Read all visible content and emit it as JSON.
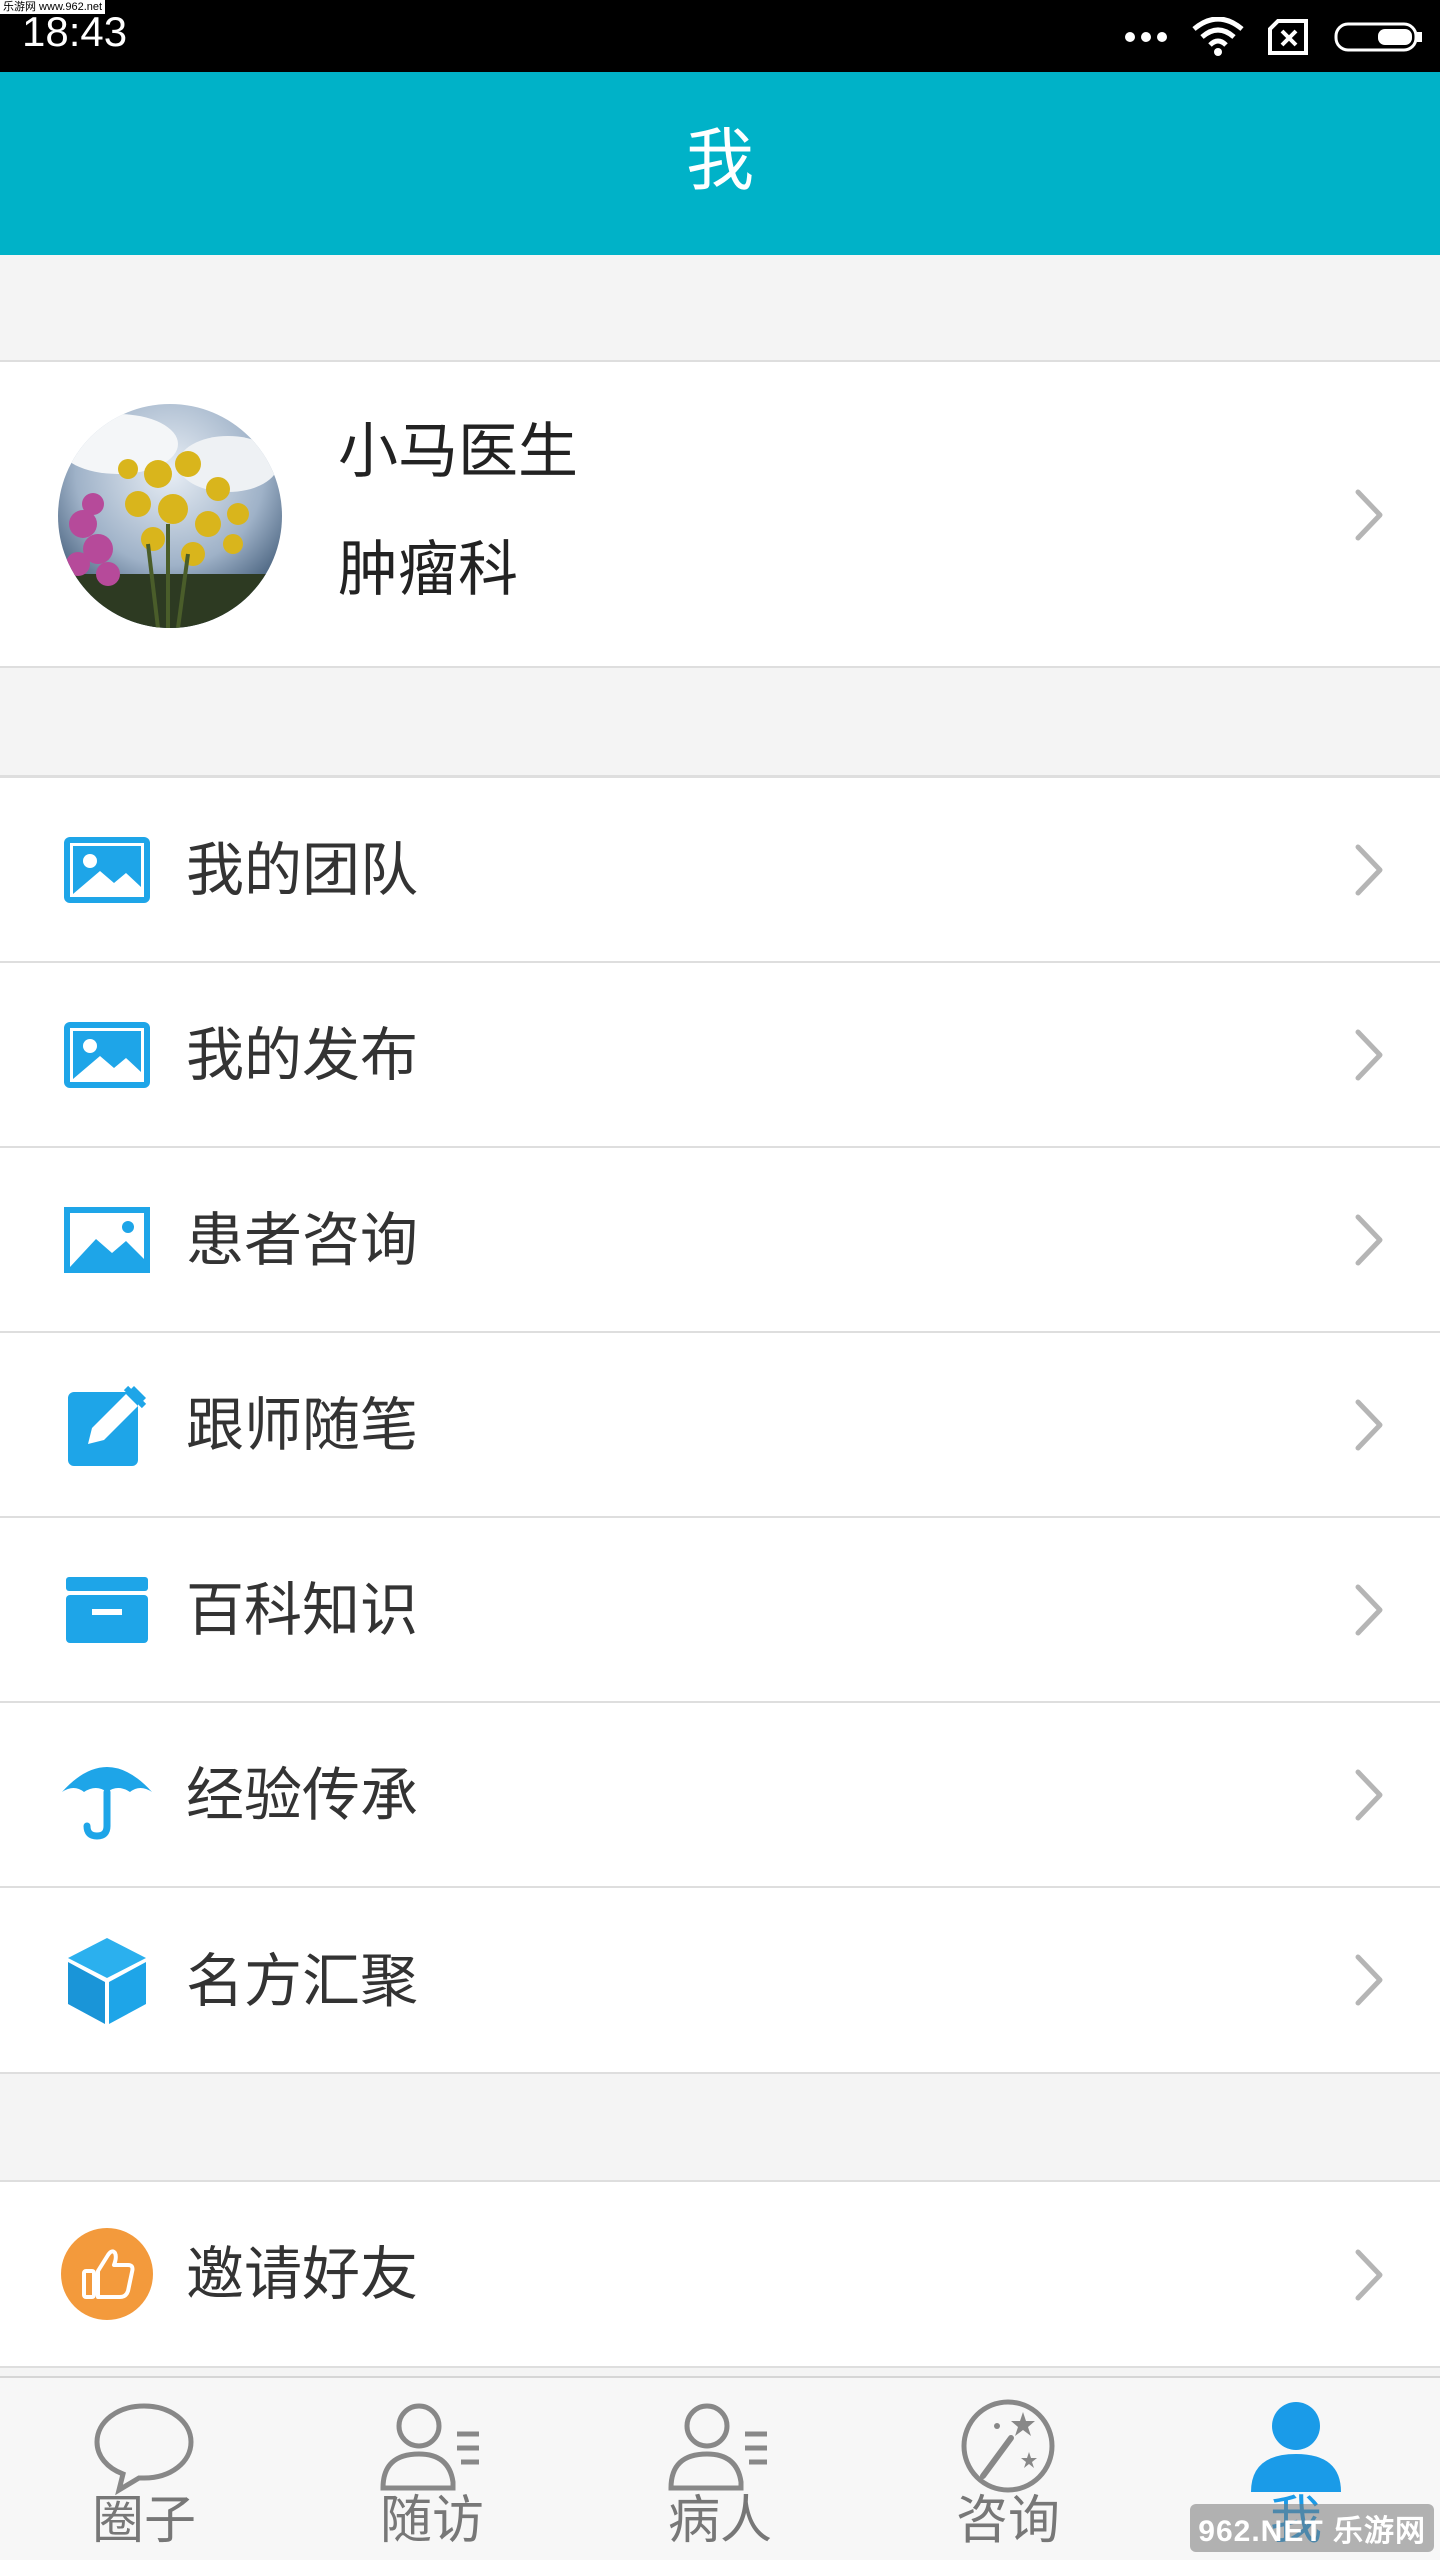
{
  "status_bar": {
    "time": "18:43",
    "watermark": "乐游网 www.962.net"
  },
  "header": {
    "title": "我"
  },
  "profile": {
    "name": "小马医生",
    "department": "肿瘤科"
  },
  "menu": {
    "items": [
      {
        "label": "我的团队",
        "icon": "image-icon"
      },
      {
        "label": "我的发布",
        "icon": "image-icon"
      },
      {
        "label": "患者咨询",
        "icon": "image-icon"
      },
      {
        "label": "跟师随笔",
        "icon": "edit-icon"
      },
      {
        "label": "百科知识",
        "icon": "archive-box-icon"
      },
      {
        "label": "经验传承",
        "icon": "umbrella-icon"
      },
      {
        "label": "名方汇聚",
        "icon": "cube-icon"
      }
    ]
  },
  "invite": {
    "label": "邀请好友",
    "icon": "thumbs-up-icon"
  },
  "bottom_nav": {
    "items": [
      {
        "label": "圈子",
        "icon": "chat-bubble-icon"
      },
      {
        "label": "随访",
        "icon": "person-list-icon"
      },
      {
        "label": "病人",
        "icon": "person-list-icon"
      },
      {
        "label": "咨询",
        "icon": "magic-wand-icon"
      },
      {
        "label": "我",
        "icon": "person-icon"
      }
    ],
    "active_index": 4,
    "watermark": "962.NET 乐游网"
  },
  "colors": {
    "header": "#00b2c8",
    "accent_blue": "#1a9be8",
    "icon_blue": "#1ea5e8",
    "invite_orange": "#f39a3c"
  }
}
